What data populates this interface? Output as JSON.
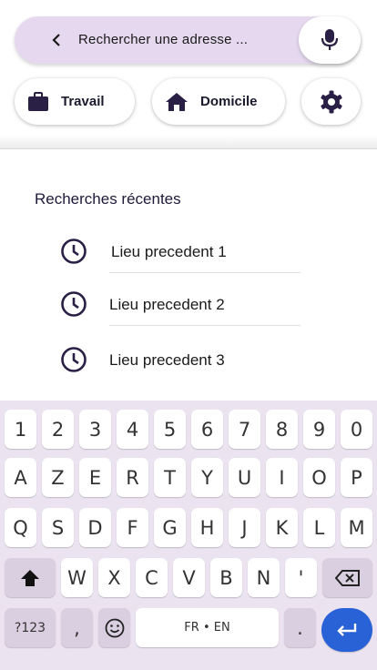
{
  "search": {
    "placeholder": "Rechercher une adresse  ..."
  },
  "icons": {
    "back": "chevron-left-icon",
    "mic": "microphone-icon",
    "work": "briefcase-icon",
    "home": "home-icon",
    "settings": "gear-icon",
    "history": "clock-icon",
    "shift": "shift-icon",
    "backspace": "backspace-icon",
    "emoji": "emoji-icon",
    "enter": "enter-icon"
  },
  "shortcuts": {
    "work_label": "Travail",
    "home_label": "Domicile"
  },
  "recent": {
    "title": "Recherches récentes",
    "items": [
      "Lieu precedent 1",
      "Lieu precedent 2",
      "Lieu precedent 3"
    ]
  },
  "keyboard": {
    "row1": [
      "1",
      "2",
      "3",
      "4",
      "5",
      "6",
      "7",
      "8",
      "9",
      "0"
    ],
    "row2": [
      "A",
      "Z",
      "E",
      "R",
      "T",
      "Y",
      "U",
      "I",
      "O",
      "P"
    ],
    "row3": [
      "Q",
      "S",
      "D",
      "F",
      "G",
      "H",
      "J",
      "K",
      "L",
      "M"
    ],
    "row4": [
      "W",
      "X",
      "C",
      "V",
      "B",
      "N",
      "'"
    ],
    "symbols": "?123",
    "comma": ",",
    "space": "FR • EN",
    "period": "."
  },
  "colors": {
    "accent": "#2961d6",
    "search_bg": "#e6d9ef",
    "icon": "#2a1f45",
    "keyboard_bg": "#ece3f1"
  }
}
